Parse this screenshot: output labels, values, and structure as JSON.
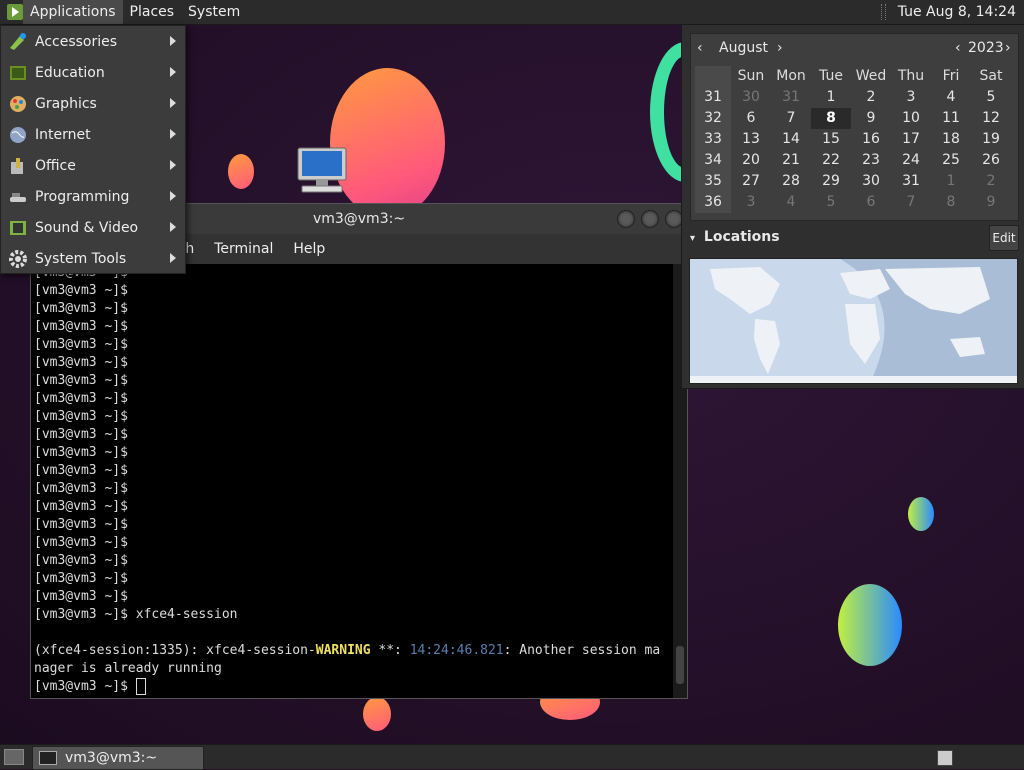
{
  "top_panel": {
    "menus": [
      "Applications",
      "Places",
      "System"
    ],
    "clock": "Tue Aug  8, 14:24"
  },
  "app_menu": {
    "items": [
      {
        "label": "Accessories",
        "icon": "accessories-icon"
      },
      {
        "label": "Education",
        "icon": "education-icon"
      },
      {
        "label": "Graphics",
        "icon": "graphics-icon"
      },
      {
        "label": "Internet",
        "icon": "internet-icon"
      },
      {
        "label": "Office",
        "icon": "office-icon"
      },
      {
        "label": "Programming",
        "icon": "programming-icon"
      },
      {
        "label": "Sound & Video",
        "icon": "sound-video-icon"
      },
      {
        "label": "System Tools",
        "icon": "system-tools-icon"
      }
    ]
  },
  "terminal": {
    "title": "vm3@vm3:~",
    "menu": [
      "Search",
      "Terminal",
      "Help"
    ],
    "menu_visible": [
      "earch",
      "Terminal",
      "Help"
    ],
    "prompt": "[vm3@vm3 ~]$",
    "command": "xfce4-session",
    "warning_prefix": "(xfce4-session:1335): xfce4-session-",
    "warning_word": "WARNING",
    "warning_stars": " **: ",
    "warning_time": "14:24:46.821",
    "warning_msg": ": Another session ma",
    "warning_msg2": "nager is already running"
  },
  "calendar": {
    "month": "August",
    "year": "2023",
    "weekdays": [
      "Sun",
      "Mon",
      "Tue",
      "Wed",
      "Thu",
      "Fri",
      "Sat"
    ],
    "weeks": [
      {
        "wk": "31",
        "days": [
          "30",
          "31",
          "1",
          "2",
          "3",
          "4",
          "5"
        ],
        "other": [
          true,
          true,
          false,
          false,
          false,
          false,
          false
        ]
      },
      {
        "wk": "32",
        "days": [
          "6",
          "7",
          "8",
          "9",
          "10",
          "11",
          "12"
        ],
        "other": [
          false,
          false,
          false,
          false,
          false,
          false,
          false
        ]
      },
      {
        "wk": "33",
        "days": [
          "13",
          "14",
          "15",
          "16",
          "17",
          "18",
          "19"
        ],
        "other": [
          false,
          false,
          false,
          false,
          false,
          false,
          false
        ]
      },
      {
        "wk": "34",
        "days": [
          "20",
          "21",
          "22",
          "23",
          "24",
          "25",
          "26"
        ],
        "other": [
          false,
          false,
          false,
          false,
          false,
          false,
          false
        ]
      },
      {
        "wk": "35",
        "days": [
          "27",
          "28",
          "29",
          "30",
          "31",
          "1",
          "2"
        ],
        "other": [
          false,
          false,
          false,
          false,
          false,
          true,
          true
        ]
      },
      {
        "wk": "36",
        "days": [
          "3",
          "4",
          "5",
          "6",
          "7",
          "8",
          "9"
        ],
        "other": [
          true,
          true,
          true,
          true,
          true,
          true,
          true
        ]
      }
    ],
    "today": "8",
    "locations_label": "Locations",
    "edit_label": "Edit"
  },
  "taskbar": {
    "window_label": "vm3@vm3:~"
  }
}
